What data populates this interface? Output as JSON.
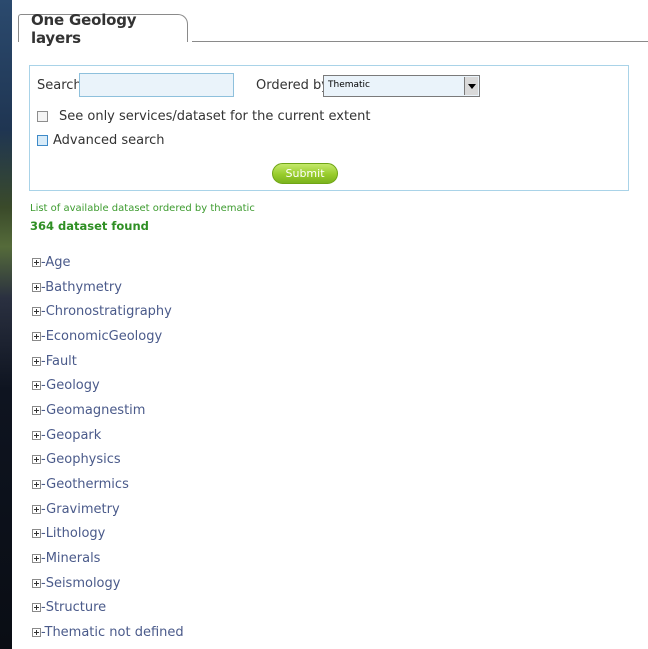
{
  "tab": {
    "label": "One Geology layers"
  },
  "search": {
    "label": "Search",
    "value": "",
    "placeholder": ""
  },
  "ordered_by": {
    "label": "Ordered by",
    "selected": "Thematic"
  },
  "options": {
    "current_extent_label": "See only services/dataset for the current extent",
    "advanced_search_label": "Advanced search"
  },
  "submit_label": "Submit",
  "results": {
    "caption": "List of available dataset ordered by thematic",
    "count_text": "364  dataset found"
  },
  "tree": {
    "items": [
      {
        "label": "-Age"
      },
      {
        "label": "-Bathymetry"
      },
      {
        "label": "-Chronostratigraphy"
      },
      {
        "label": "-EconomicGeology"
      },
      {
        "label": "-Fault"
      },
      {
        "label": "-Geology"
      },
      {
        "label": "-Geomagnestim"
      },
      {
        "label": "-Geopark"
      },
      {
        "label": "-Geophysics"
      },
      {
        "label": "-Geothermics"
      },
      {
        "label": "-Gravimetry"
      },
      {
        "label": "-Lithology"
      },
      {
        "label": "-Minerals"
      },
      {
        "label": "-Seismology"
      },
      {
        "label": "-Structure"
      },
      {
        "label": "-Thematic not defined"
      }
    ]
  },
  "colors": {
    "panel_border": "#a9d3e8",
    "submit_green": "#98cc2c",
    "count_green": "#2f8f24",
    "tree_text": "#4a5a8a"
  }
}
